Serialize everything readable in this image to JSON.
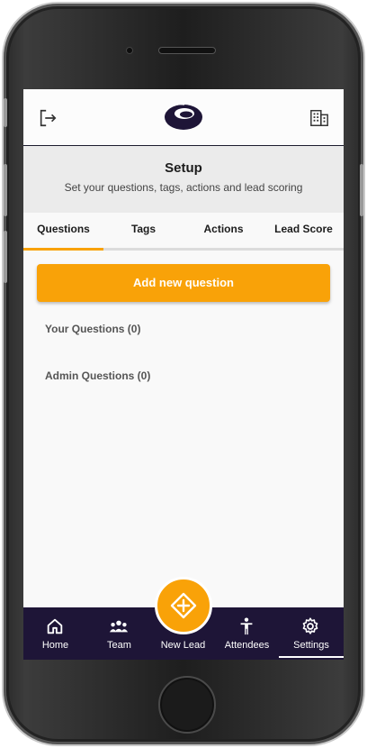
{
  "header": {
    "logout_icon": "logout-icon",
    "logo_icon": "brand-logo",
    "building_icon": "building-icon"
  },
  "setup": {
    "title": "Setup",
    "subtitle": "Set your questions, tags, actions and lead scoring"
  },
  "tabs": [
    {
      "label": "Questions",
      "active": true
    },
    {
      "label": "Tags",
      "active": false
    },
    {
      "label": "Actions",
      "active": false
    },
    {
      "label": "Lead Score",
      "active": false
    }
  ],
  "main": {
    "add_button_label": "Add new question",
    "your_questions_label": "Your Questions (0)",
    "admin_questions_label": "Admin Questions (0)"
  },
  "bottom_nav": {
    "items": [
      {
        "label": "Home",
        "icon": "home-icon",
        "active": false
      },
      {
        "label": "Team",
        "icon": "team-icon",
        "active": false
      },
      {
        "label": "New Lead",
        "icon": "add-lead-icon",
        "active": false
      },
      {
        "label": "Attendees",
        "icon": "person-icon",
        "active": false
      },
      {
        "label": "Settings",
        "icon": "gear-icon",
        "active": true
      }
    ]
  },
  "colors": {
    "accent": "#f9a208",
    "nav_background": "#1e1537",
    "header_background": "#ebebeb"
  }
}
